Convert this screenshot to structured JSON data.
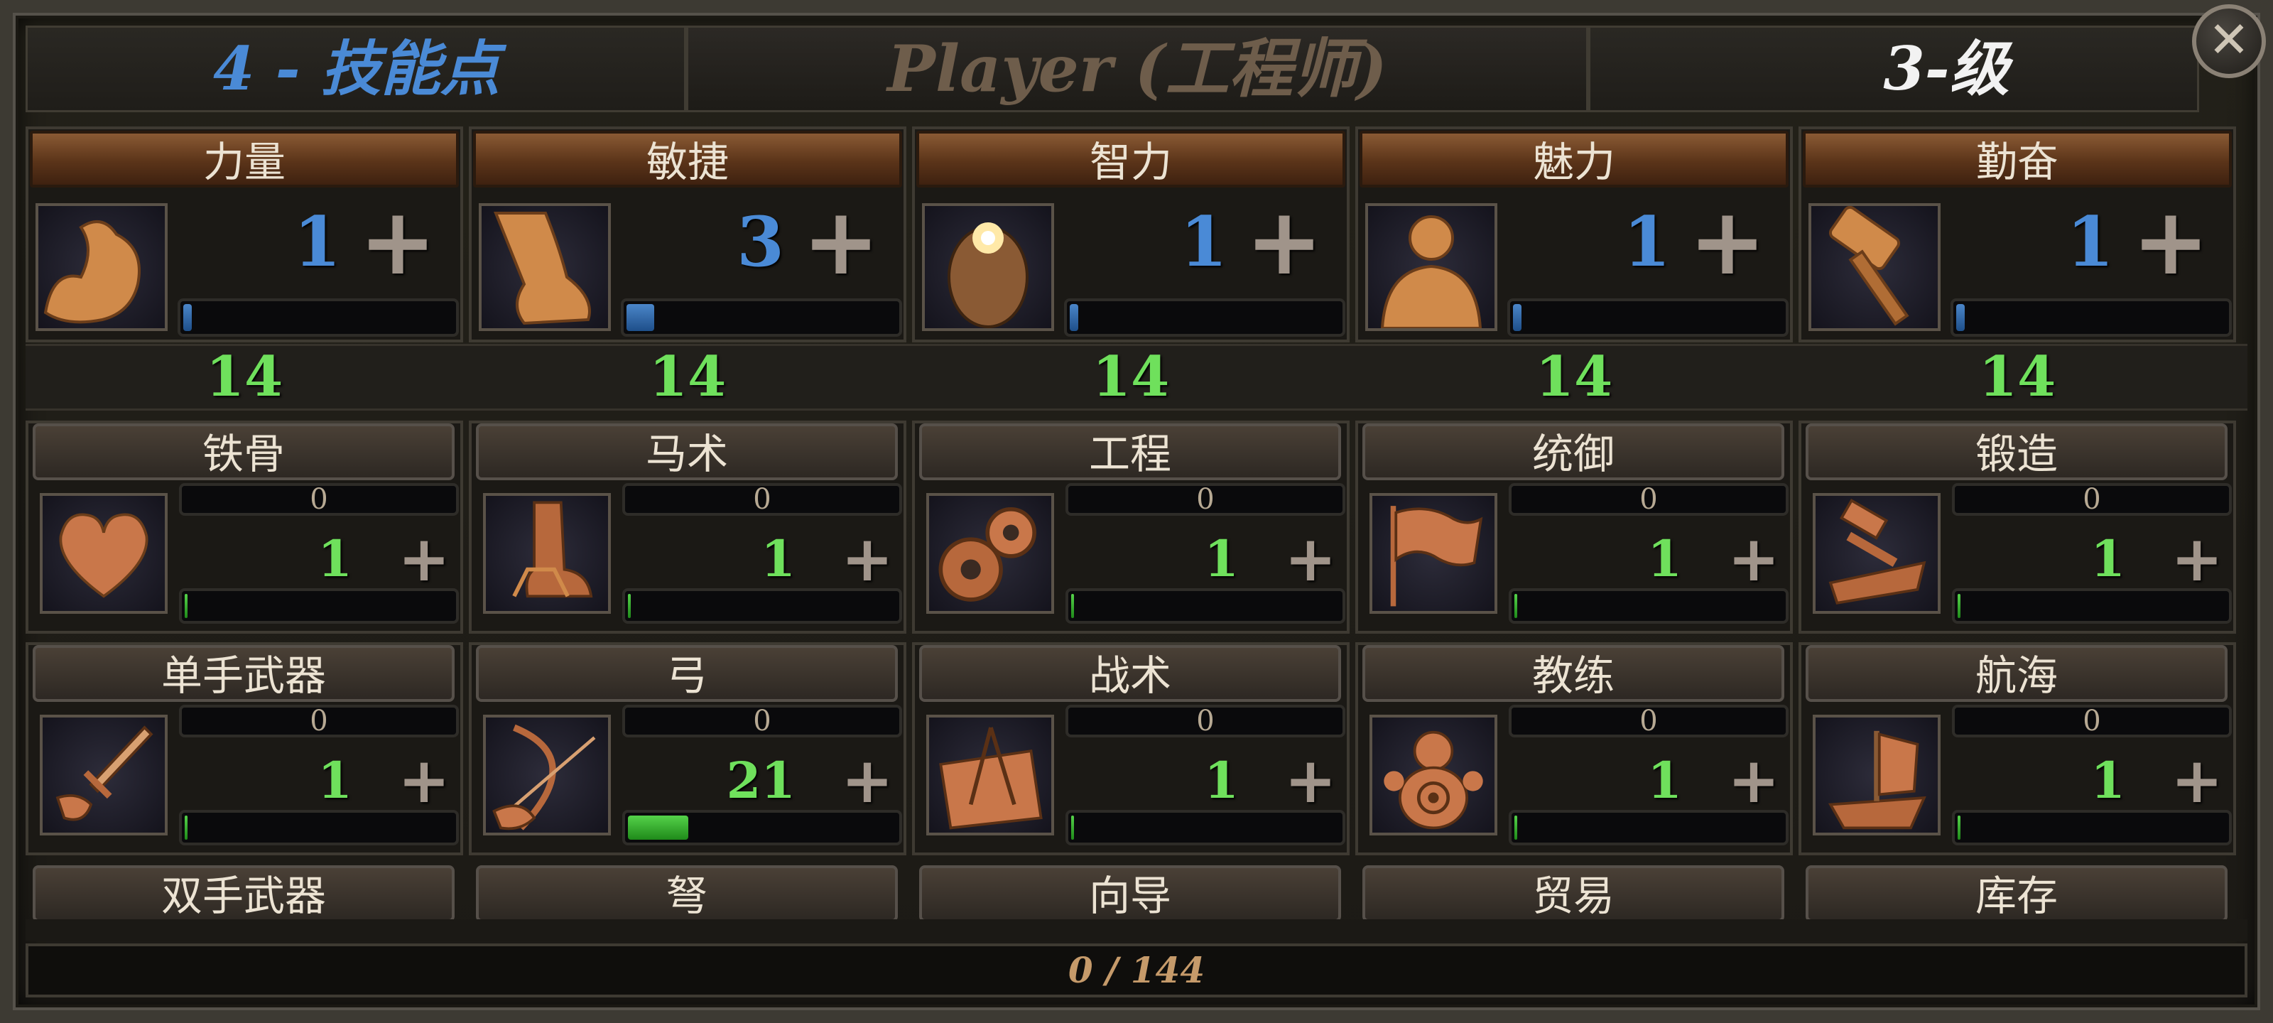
{
  "header": {
    "skill_points": "4 - 技能点",
    "player_name": "Player (工程师)",
    "level": "3-级",
    "close_symbol": "✕"
  },
  "colors": {
    "blue": "#4a8ad6",
    "green": "#6fe05c",
    "bronze": "#8a5a34"
  },
  "attributes": [
    {
      "label": "力量",
      "value": "1",
      "plus": "+",
      "base": "14",
      "icon": "flexed-arm-icon",
      "progress": 0.03
    },
    {
      "label": "敏捷",
      "value": "3",
      "plus": "+",
      "base": "14",
      "icon": "leg-icon",
      "progress": 0.1
    },
    {
      "label": "智力",
      "value": "1",
      "plus": "+",
      "base": "14",
      "icon": "glowing-head-icon",
      "progress": 0.03
    },
    {
      "label": "魅力",
      "value": "1",
      "plus": "+",
      "base": "14",
      "icon": "bare-torso-icon",
      "progress": 0.03
    },
    {
      "label": "勤奋",
      "value": "1",
      "plus": "+",
      "base": "14",
      "icon": "hammer-icon",
      "progress": 0.03
    }
  ],
  "skills": [
    {
      "label": "铁骨",
      "exp": "0",
      "value": "1",
      "plus": "+",
      "icon": "heart-icon",
      "progress": 0.01
    },
    {
      "label": "马术",
      "exp": "0",
      "value": "1",
      "plus": "+",
      "icon": "boot-stirrup-icon",
      "progress": 0.01
    },
    {
      "label": "工程",
      "exp": "0",
      "value": "1",
      "plus": "+",
      "icon": "gears-icon",
      "progress": 0.01
    },
    {
      "label": "统御",
      "exp": "0",
      "value": "1",
      "plus": "+",
      "icon": "flag-icon",
      "progress": 0.01
    },
    {
      "label": "锻造",
      "exp": "0",
      "value": "1",
      "plus": "+",
      "icon": "anvil-hammer-icon",
      "progress": 0.01
    },
    {
      "label": "单手武器",
      "exp": "0",
      "value": "1",
      "plus": "+",
      "icon": "sword-icon",
      "progress": 0.01
    },
    {
      "label": "弓",
      "exp": "0",
      "value": "21",
      "plus": "+",
      "icon": "bow-icon",
      "progress": 0.22
    },
    {
      "label": "战术",
      "exp": "0",
      "value": "1",
      "plus": "+",
      "icon": "map-compass-icon",
      "progress": 0.01
    },
    {
      "label": "教练",
      "exp": "0",
      "value": "1",
      "plus": "+",
      "icon": "training-dummy-icon",
      "progress": 0.01
    },
    {
      "label": "航海",
      "exp": "0",
      "value": "1",
      "plus": "+",
      "icon": "ship-icon",
      "progress": 0.01
    }
  ],
  "partial_skills": [
    "双手武器",
    "弩",
    "向导",
    "贸易",
    "库存"
  ],
  "footer": {
    "exp": "0 / 144"
  }
}
